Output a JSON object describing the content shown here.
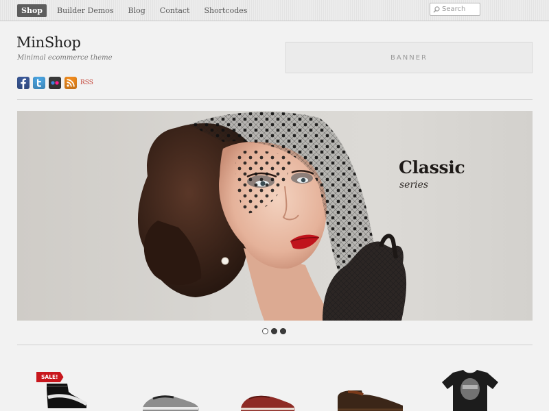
{
  "nav": {
    "items": [
      {
        "label": "Shop",
        "active": true
      },
      {
        "label": "Builder Demos",
        "active": false
      },
      {
        "label": "Blog",
        "active": false
      },
      {
        "label": "Contact",
        "active": false
      },
      {
        "label": "Shortcodes",
        "active": false
      }
    ],
    "search_placeholder": "Search"
  },
  "header": {
    "site_title": "MinShop",
    "tagline": "Minimal ecommerce theme",
    "banner_label": "BANNER",
    "social": {
      "icons": [
        "facebook-icon",
        "twitter-icon",
        "flickr-icon",
        "rss-icon"
      ],
      "rss_label": "RSS"
    }
  },
  "slider": {
    "heading": "Classic",
    "subheading": "series",
    "slide_count": 3,
    "active_slide": 1
  },
  "products": {
    "sale_badge": "SALE!",
    "items": [
      "black-high-top-sneaker",
      "grey-low-sneaker",
      "red-low-sneaker",
      "brown-leather-shoe",
      "black-graphic-tshirt"
    ]
  },
  "colors": {
    "accent_red": "#c8171d",
    "nav_active": "#5c5c5c",
    "rss_text": "#c0392b"
  }
}
